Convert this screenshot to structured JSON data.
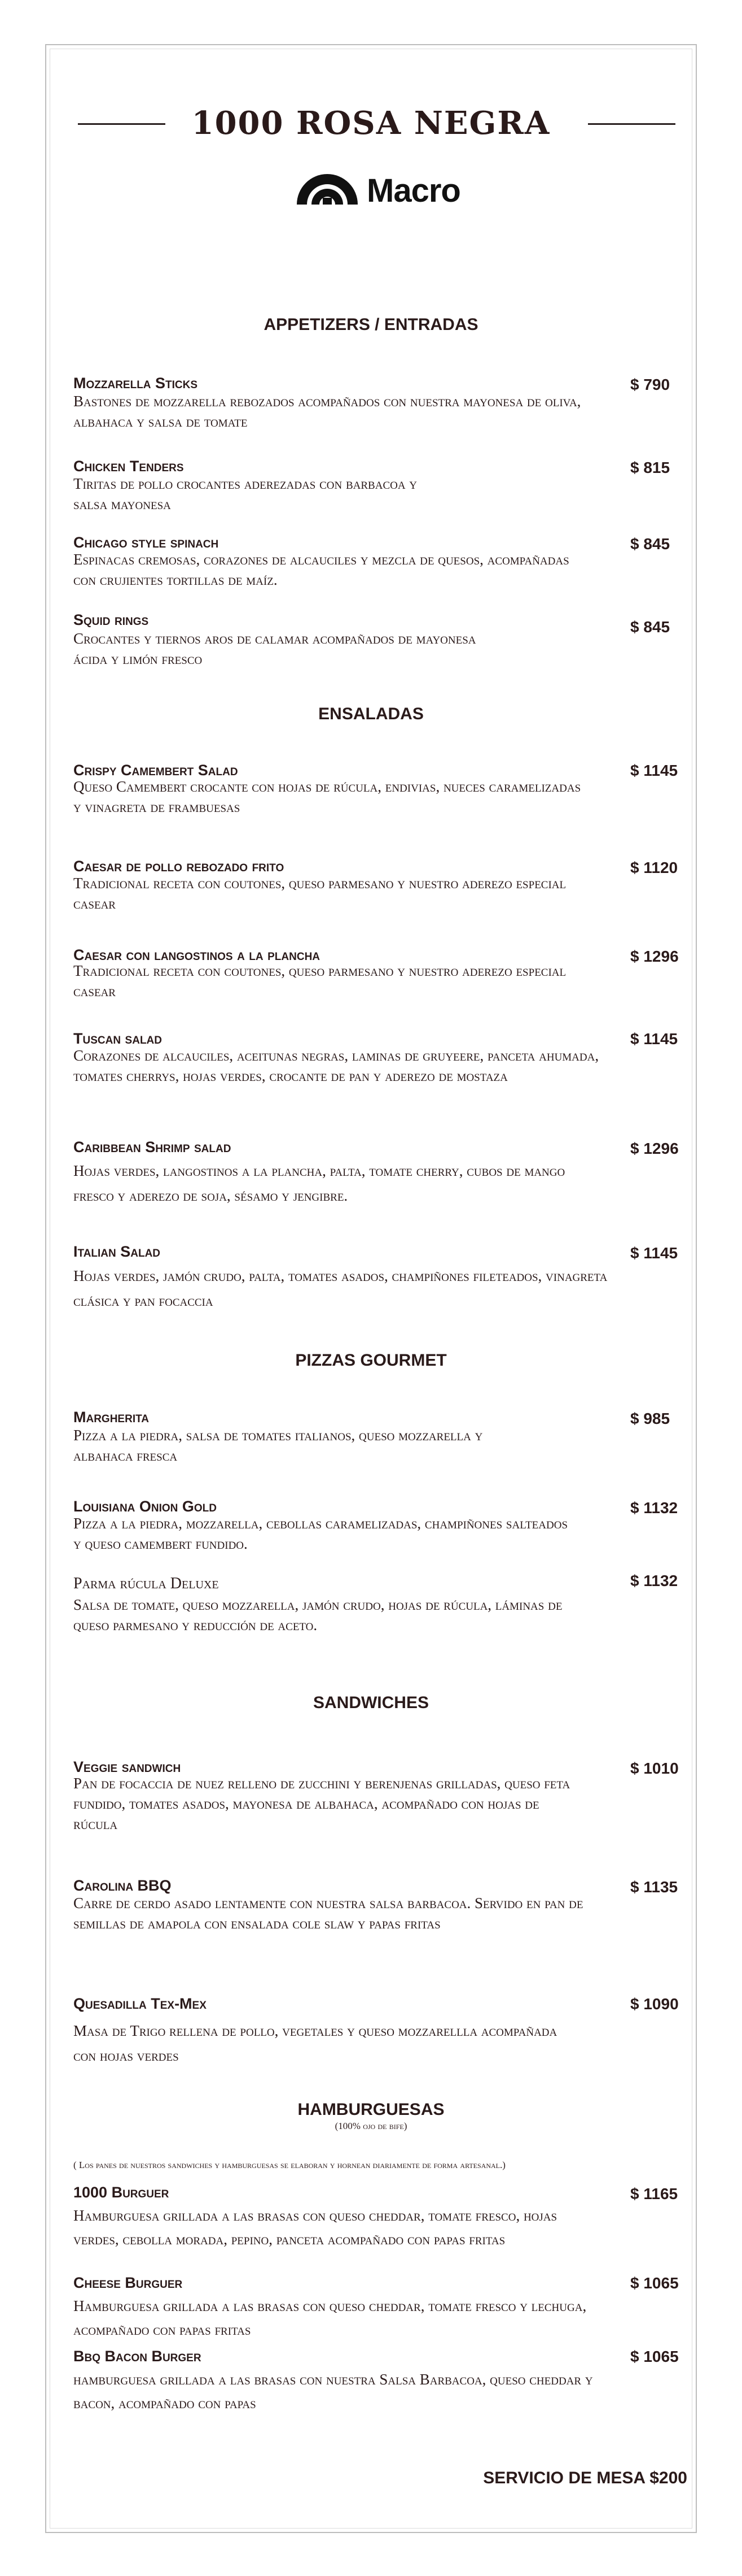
{
  "header": {
    "title": "1000 ROSA NEGRA",
    "logo_text": "Macro",
    "logo_icon": "macro-logo-icon"
  },
  "sections": {
    "appetizers": {
      "title": "APPETIZERS / ENTRADAS",
      "items": [
        {
          "name": "Mozzarella Sticks",
          "desc": "Bastones de mozzarella rebozados acompañados con nuestra mayonesa de oliva, albahaca y salsa de tomate",
          "price": "$ 790"
        },
        {
          "name": "Chicken Tenders",
          "desc": "Tiritas de pollo crocantes aderezadas con barbacoa y salsa mayonesa",
          "price": "$ 815"
        },
        {
          "name": "Chicago style spinach",
          "desc": "Espinacas cremosas, corazones de alcauciles y mezcla de quesos, acompañadas con crujientes tortillas de maíz.",
          "price": "$ 845"
        },
        {
          "name": "Squid rings",
          "desc": "Crocantes y tiernos aros de calamar acompañados de mayonesa ácida y limón fresco",
          "price": "$ 845"
        }
      ]
    },
    "salads": {
      "title": "ENSALADAS",
      "items": [
        {
          "name": "Crispy Camembert Salad",
          "desc": "Queso Camembert crocante con hojas de rúcula, endivias, nueces caramelizadas y vinagreta de frambuesas",
          "price": "$ 1145"
        },
        {
          "name": "Caesar de pollo rebozado frito",
          "desc": "Tradicional receta con coutones, queso parmesano y nuestro aderezo especial casear",
          "price": "$ 1120"
        },
        {
          "name": "Caesar con langostinos a la plancha",
          "desc": "Tradicional receta con coutones, queso parmesano y nuestro aderezo especial casear",
          "price": "$ 1296"
        },
        {
          "name": "Tuscan salad",
          "desc": "Corazones de alcauciles, aceitunas negras, laminas de gruyeere, panceta ahumada, tomates cherrys, hojas verdes, crocante de pan y aderezo de mostaza",
          "price": "$ 1145"
        },
        {
          "name": "Caribbean Shrimp salad",
          "desc": "Hojas verdes, langostinos a la plancha, palta, tomate cherry, cubos de mango fresco y aderezo de soja, sésamo y jengibre.",
          "price": "$ 1296"
        },
        {
          "name": "Italian Salad",
          "desc": "Hojas verdes, jamón crudo, palta, tomates asados, champiñones fileteados, vinagreta clásica y pan focaccia",
          "price": "$ 1145"
        }
      ]
    },
    "pizzas": {
      "title": "PIZZAS GOURMET",
      "items": [
        {
          "name": "Margherita",
          "desc": "Pizza a la piedra, salsa de tomates italianos, queso mozzarella y albahaca fresca",
          "price": "$ 985"
        },
        {
          "name": "Louisiana Onion Gold",
          "desc": "Pizza a la piedra, mozzarella, cebollas caramelizadas, champiñones salteados y queso camembert fundido.",
          "price": "$ 1132"
        },
        {
          "name": "Parma rúcula Deluxe",
          "desc": "Salsa de tomate, queso mozzarella, jamón crudo, hojas de rúcula, láminas de queso parmesano y reducción de aceto.",
          "price": "$ 1132"
        }
      ]
    },
    "sandwiches": {
      "title": "SANDWICHES",
      "items": [
        {
          "name": "Veggie sandwich",
          "desc": "Pan de focaccia de nuez relleno de zucchini y berenjenas grilladas, queso feta fundido, tomates asados, mayonesa de albahaca, acompañado con hojas de rúcula",
          "price": "$ 1010"
        },
        {
          "name": "Carolina BBQ",
          "desc": "Carre de cerdo asado lentamente con nuestra salsa barbacoa. Servido en pan de semillas de amapola con ensalada cole slaw y papas fritas",
          "price": "$ 1135"
        },
        {
          "name": "Quesadilla Tex-Mex",
          "desc": "Masa de Trigo rellena de pollo, vegetales y queso mozzarellla acompañada con hojas verdes",
          "price": "$ 1090"
        }
      ]
    },
    "burgers": {
      "title": "HAMBURGUESAS",
      "subtitle": "(100% ojo de bife)",
      "note": "( Los panes de nuestros sandwiches y hamburguesas se elaboran y hornean diariamente de forma artesanal.)",
      "items": [
        {
          "name": "1000 Burguer",
          "desc": "Hamburguesa grillada a las brasas con queso cheddar, tomate fresco, hojas verdes, cebolla morada, pepino, panceta acompañado con papas fritas",
          "price": "$ 1165"
        },
        {
          "name": "Cheese Burguer",
          "desc": "Hamburguesa grillada a las brasas con queso cheddar, tomate fresco y lechuga, acompañado con papas fritas",
          "price": "$ 1065"
        },
        {
          "name": "Bbq Bacon Burger",
          "desc": "hamburguesa grillada a las brasas con nuestra Salsa Barbacoa, queso cheddar y bacon, acompañado con papas",
          "price": "$ 1065"
        }
      ]
    }
  },
  "footer": {
    "service": "SERVICIO DE MESA $200"
  }
}
